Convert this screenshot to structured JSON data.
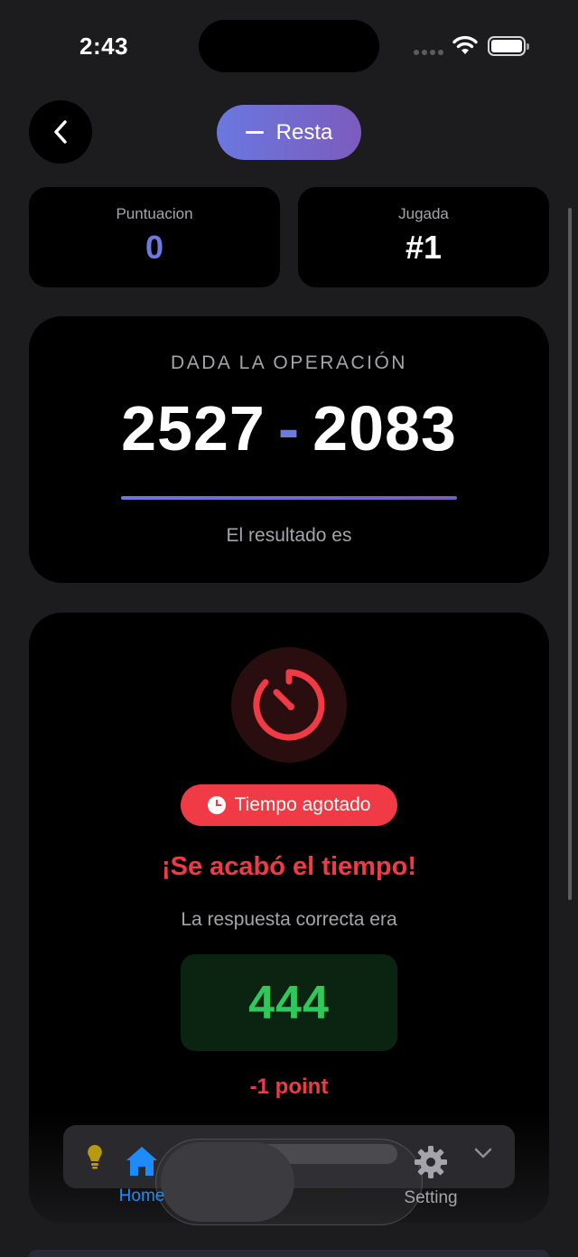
{
  "status": {
    "time": "2:43"
  },
  "header": {
    "mode_label": "Resta"
  },
  "stats": {
    "score_label": "Puntuacion",
    "score_value": "0",
    "play_label": "Jugada",
    "play_value": "#1"
  },
  "operation": {
    "heading": "DADA LA OPERACIÓN",
    "left": "2527",
    "operator": "-",
    "right": "2083",
    "subtitle": "El resultado es"
  },
  "result": {
    "badge": "Tiempo agotado",
    "title": "¡Se acabó el tiempo!",
    "correct_label": "La respuesta correcta era",
    "answer": "444",
    "penalty": "-1 point"
  },
  "tabs": {
    "home": "Home",
    "setting": "Setting"
  },
  "colors": {
    "accent": "#6f7ae0",
    "danger": "#f03a45",
    "success": "#30c85a",
    "tab_active": "#1d8cf8"
  }
}
